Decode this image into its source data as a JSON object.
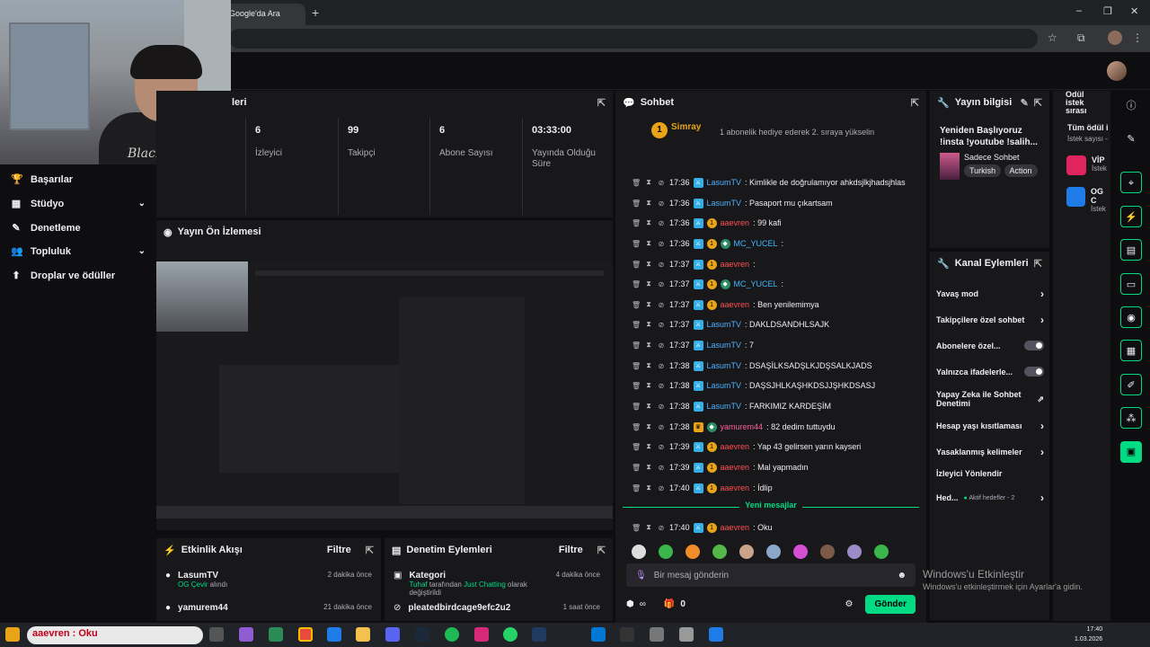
{
  "browser": {
    "tab_title": "Google'da Ara",
    "new_tab": "+",
    "min": "–",
    "max": "❐",
    "close": "✕"
  },
  "nav": {
    "items": [
      {
        "label": "Başarılar",
        "icon": "trophy-icon",
        "glyph": "🏆"
      },
      {
        "label": "Stüdyo",
        "icon": "studio-icon",
        "glyph": "▦",
        "chevron": "⌄"
      },
      {
        "label": "Denetleme",
        "icon": "wrench-icon",
        "glyph": "✎"
      },
      {
        "label": "Topluluk",
        "icon": "community-icon",
        "glyph": "👥",
        "chevron": "⌄"
      },
      {
        "label": "Droplar ve ödüller",
        "icon": "drops-icon",
        "glyph": "⬆"
      }
    ]
  },
  "stats": {
    "title": "leri",
    "items": [
      {
        "value": "6",
        "label": "İzleyici"
      },
      {
        "value": "99",
        "label": "Takipçi"
      },
      {
        "value": "6",
        "label": "Abone Sayısı"
      },
      {
        "value": "03:33:00",
        "label": "Yayında Olduğu Süre"
      }
    ]
  },
  "preview": {
    "title": "Yayın Ön İzlemesi"
  },
  "activity": {
    "title": "Etkinlik Akışı",
    "filter": "Filtre",
    "items": [
      {
        "user": "LasumTV",
        "sub_green": "OG Çevir",
        "sub_rest": " alındı",
        "time": "2 dakika önce"
      },
      {
        "user": "yamurem44",
        "sub_green": "",
        "sub_rest": "",
        "time": "21 dakika önce"
      }
    ]
  },
  "modlog": {
    "title": "Denetim Eylemleri",
    "filter": "Filtre",
    "items": [
      {
        "title": "Kategori",
        "sub_green1": "Tuhaf",
        "sub_mid": " tarafından ",
        "sub_green2": "Just Chatting",
        "sub_rest": " olarak değiştirildi",
        "time": "4 dakika önce"
      },
      {
        "title": "pleatedbirdcage9efc2u2",
        "time": "1 saat önce"
      }
    ]
  },
  "chat": {
    "title": "Sohbet",
    "banner_user": "Simray",
    "banner_rank": "1",
    "banner_text": "1 abonelik hediye ederek 2. sıraya yükselin",
    "messages": [
      {
        "time": "17:36",
        "user": "LasumTV",
        "color": "user-blue",
        "badges": [
          "mod"
        ],
        "text": ": Kimlikle de doğrulamıyor ahkdsjlkjhadsjhlas"
      },
      {
        "time": "17:36",
        "user": "LasumTV",
        "color": "user-blue",
        "badges": [
          "mod"
        ],
        "text": ": Pasaport mu çıkartsam"
      },
      {
        "time": "17:36",
        "user": "aaevren",
        "color": "user-red",
        "badges": [
          "mod",
          "sub"
        ],
        "text": ": 99 kafi"
      },
      {
        "time": "17:36",
        "user": "MC_YUCEL",
        "color": "user-cyan",
        "badges": [
          "mod",
          "sub",
          "gl"
        ],
        "text": ":"
      },
      {
        "time": "17:37",
        "user": "aaevren",
        "color": "user-red",
        "badges": [
          "mod",
          "sub"
        ],
        "text": ":"
      },
      {
        "time": "17:37",
        "user": "MC_YUCEL",
        "color": "user-cyan",
        "badges": [
          "mod",
          "sub",
          "gl"
        ],
        "text": ":"
      },
      {
        "time": "17:37",
        "user": "aaevren",
        "color": "user-red",
        "badges": [
          "mod",
          "sub"
        ],
        "text": ": Ben yenilemimya"
      },
      {
        "time": "17:37",
        "user": "LasumTV",
        "color": "user-blue",
        "badges": [
          "mod"
        ],
        "text": ": DAKLDSANDHLSAJK"
      },
      {
        "time": "17:37",
        "user": "LasumTV",
        "color": "user-blue",
        "badges": [
          "mod"
        ],
        "text": ": 7"
      },
      {
        "time": "17:38",
        "user": "LasumTV",
        "color": "user-blue",
        "badges": [
          "mod"
        ],
        "text": ": DSAŞİLKSADŞLKJDŞSALKJADS"
      },
      {
        "time": "17:38",
        "user": "LasumTV",
        "color": "user-blue",
        "badges": [
          "mod"
        ],
        "text": ": DAŞSJHLKAŞHKDSJJŞHKDSASJ"
      },
      {
        "time": "17:38",
        "user": "LasumTV",
        "color": "user-blue",
        "badges": [
          "mod"
        ],
        "text": ": FARKIMIZ KARDEŞİM"
      },
      {
        "time": "17:38",
        "user": "yamurem44",
        "color": "user-pink",
        "badges": [
          "vip",
          "gl"
        ],
        "text": ": 82 dedim tuttuydu"
      },
      {
        "time": "17:39",
        "user": "aaevren",
        "color": "user-red",
        "badges": [
          "mod",
          "sub"
        ],
        "text": ": Yap 43 gelirsen yarın kayseri"
      },
      {
        "time": "17:39",
        "user": "aaevren",
        "color": "user-red",
        "badges": [
          "mod",
          "sub"
        ],
        "text": ": Mal yapmadın"
      },
      {
        "time": "17:40",
        "user": "aaevren",
        "color": "user-red",
        "badges": [
          "mod",
          "sub"
        ],
        "text": ": İdlip"
      },
      {
        "time": "17:40",
        "user": "aaevren",
        "color": "user-red",
        "badges": [
          "mod",
          "sub"
        ],
        "text": ": Oku"
      }
    ],
    "new_messages": "Yeni mesajlar",
    "placeholder": "Bir mesaj gönderin",
    "points": "∞",
    "gift_count": "0",
    "send": "Gönder"
  },
  "info": {
    "title": "Yayın bilgisi",
    "stream_title": "Yeniden Başlıyoruz !insta !youtube !salih...",
    "category": "Sadece Sohbet",
    "tags": [
      "Turkish",
      "Action"
    ]
  },
  "actions": {
    "title": "Kanal Eylemleri",
    "items": [
      {
        "label": "Yavaş mod",
        "kind": "arrow"
      },
      {
        "label": "Takipçilere özel sohbet",
        "kind": "arrow"
      },
      {
        "label": "Abonelere özel...",
        "kind": "toggle"
      },
      {
        "label": "Yalnızca ifadelerle...",
        "kind": "toggle"
      },
      {
        "label": "Yapay Zeka ile Sohbet Denetimi",
        "kind": "ext"
      },
      {
        "label": "Hesap yaşı kısıtlaması",
        "kind": "arrow"
      },
      {
        "label": "Yasaklanmış kelimeler",
        "kind": "arrow"
      },
      {
        "label": "İzleyici Yönlendir",
        "kind": "none"
      },
      {
        "label": "Hed...",
        "kind": "arrow",
        "extra": "Aktif hedefler - 2"
      }
    ]
  },
  "rewards": {
    "title": "Ödül istek sırası",
    "sub": "Tüm ödül i",
    "sub2": "İstek sayısı -",
    "items": [
      {
        "label": "VİP",
        "sub": "İstek",
        "color": "#e0245e"
      },
      {
        "label": "OG C",
        "sub": "İstek",
        "color": "#1e7be8"
      }
    ]
  },
  "taskbar": {
    "search_text": "aaevren : Oku",
    "time": "17:40",
    "date": "1.03.2026"
  },
  "watermark": {
    "line1": "Windows'u Etkinleştir",
    "line2": "Windows'u etkinleştirmek için Ayarlar'a gidin."
  },
  "webcam": {
    "shirt_text": "Black"
  },
  "colors": {
    "accent": "#00db84",
    "mod": "#34aee6",
    "sub": "#e8a317"
  }
}
